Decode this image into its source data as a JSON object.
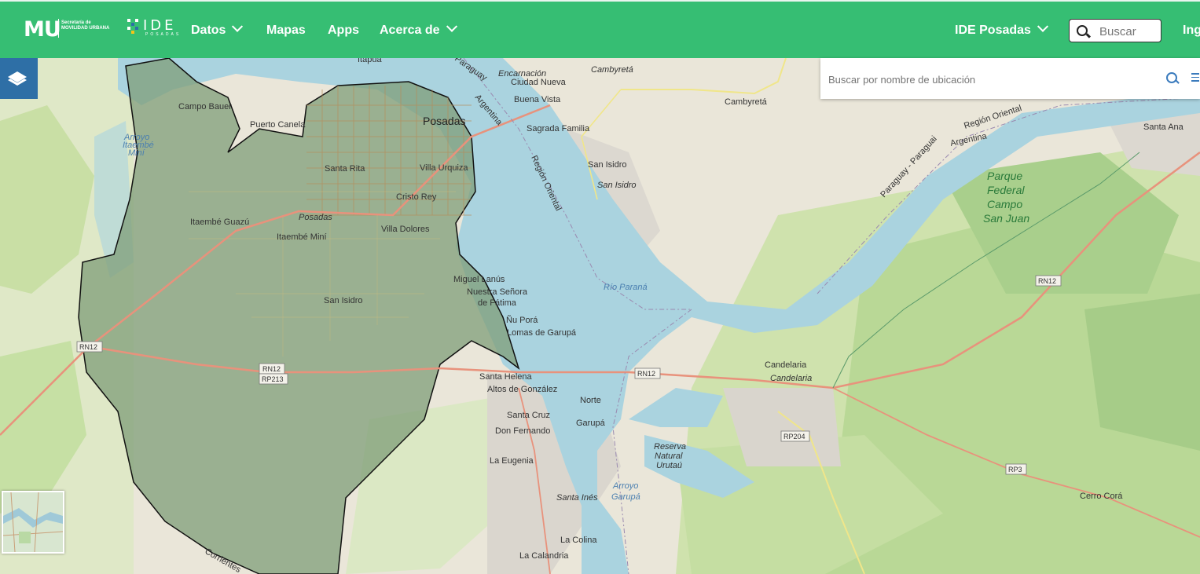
{
  "header": {
    "logo_mu": "MU",
    "logo_mu_sub": "Secretaría de MOVILIDAD URBANA",
    "logo_ide": "IDE",
    "logo_ide_sub": "POSADAS",
    "nav": [
      {
        "label": "Datos",
        "dropdown": true
      },
      {
        "label": "Mapas",
        "dropdown": false
      },
      {
        "label": "Apps",
        "dropdown": false
      },
      {
        "label": "Acerca de",
        "dropdown": true
      }
    ],
    "ide_select": "IDE Posadas",
    "search_placeholder": "Buscar",
    "login_partial": "Ing"
  },
  "map": {
    "location_search_placeholder": "Buscar por nombre de ubicación",
    "labels": {
      "posadas": "Posadas",
      "posadas_it": "Posadas",
      "encarnacion": "Encarnación",
      "ciudad_nueva": "Ciudad Nueva",
      "buena_vista": "Buena Vista",
      "cambyreta_it": "Cambyretá",
      "cambyreta": "Cambyretá",
      "sagrada_familia": "Sagrada Familia",
      "san_isidro_py": "San Isidro",
      "san_isidro_py_it": "San Isidro",
      "campo_bauer": "Campo Bauer",
      "puerto_canela": "Puerto Canela",
      "santa_rita": "Santa Rita",
      "villa_urquiza": "Villa Urquiza",
      "cristo_rey": "Cristo Rey",
      "itaembe_guazu": "Itaembé Guazú",
      "itaembe_mini": "Itaembé Miní",
      "villa_dolores": "Villa Dolores",
      "san_isidro": "San Isidro",
      "miguel_lanus": "Miguel Lanús",
      "nuestra_senora": "Nuestra Señora",
      "de_fatima": "de Fátima",
      "nu_pora": "Ñu Porá",
      "lomas_garupa": "Lomas de Garupá",
      "santa_helena": "Santa Helena",
      "altos_gonzalez": "Altos de González",
      "norte": "Norte",
      "santa_cruz": "Santa Cruz",
      "don_fernando": "Don Fernando",
      "garupa": "Garupá",
      "la_eugenia": "La Eugenia",
      "santa_ines": "Santa Inés",
      "la_colina": "La Colina",
      "la_calandria": "La Calandria",
      "candelaria": "Candelaria",
      "candelaria_it": "Candelaria",
      "rio_parana": "Río Paraná",
      "arroyo_garupa_1": "Arroyo",
      "arroyo_garupa_2": "Garupá",
      "arroyo_itaembe_1": "Arroyo",
      "arroyo_itaembe_2": "Itaembé",
      "arroyo_itaembe_3": "Miní",
      "reserva_1": "Reserva",
      "reserva_2": "Natural",
      "reserva_3": "Urutaú",
      "parque_1": "Parque",
      "parque_2": "Federal",
      "parque_3": "Campo",
      "parque_4": "San Juan",
      "santa_ana": "Santa Ana",
      "cerro_cora": "Cerro Corá",
      "region_oriental_1": "Región Oriental",
      "region_oriental_2": "Región Oriental",
      "argentina_1": "Argentina",
      "argentina_2": "Argentina",
      "paraguay_1": "Paraguay",
      "paraguay_2": "Paraguay - Paraguai",
      "paraguay_3": "Paraguay - Paraguai",
      "itapua": "Itapúa",
      "corrientes": "Corrientes"
    },
    "road_shields": [
      "RN12",
      "RN12",
      "RP213",
      "RN12",
      "RN12",
      "RP204",
      "RP3"
    ],
    "colors": {
      "header": "#36be73",
      "water": "#aad3df",
      "municipality_fill": "#7f9e78",
      "layers_button": "#2e6fa6"
    }
  }
}
